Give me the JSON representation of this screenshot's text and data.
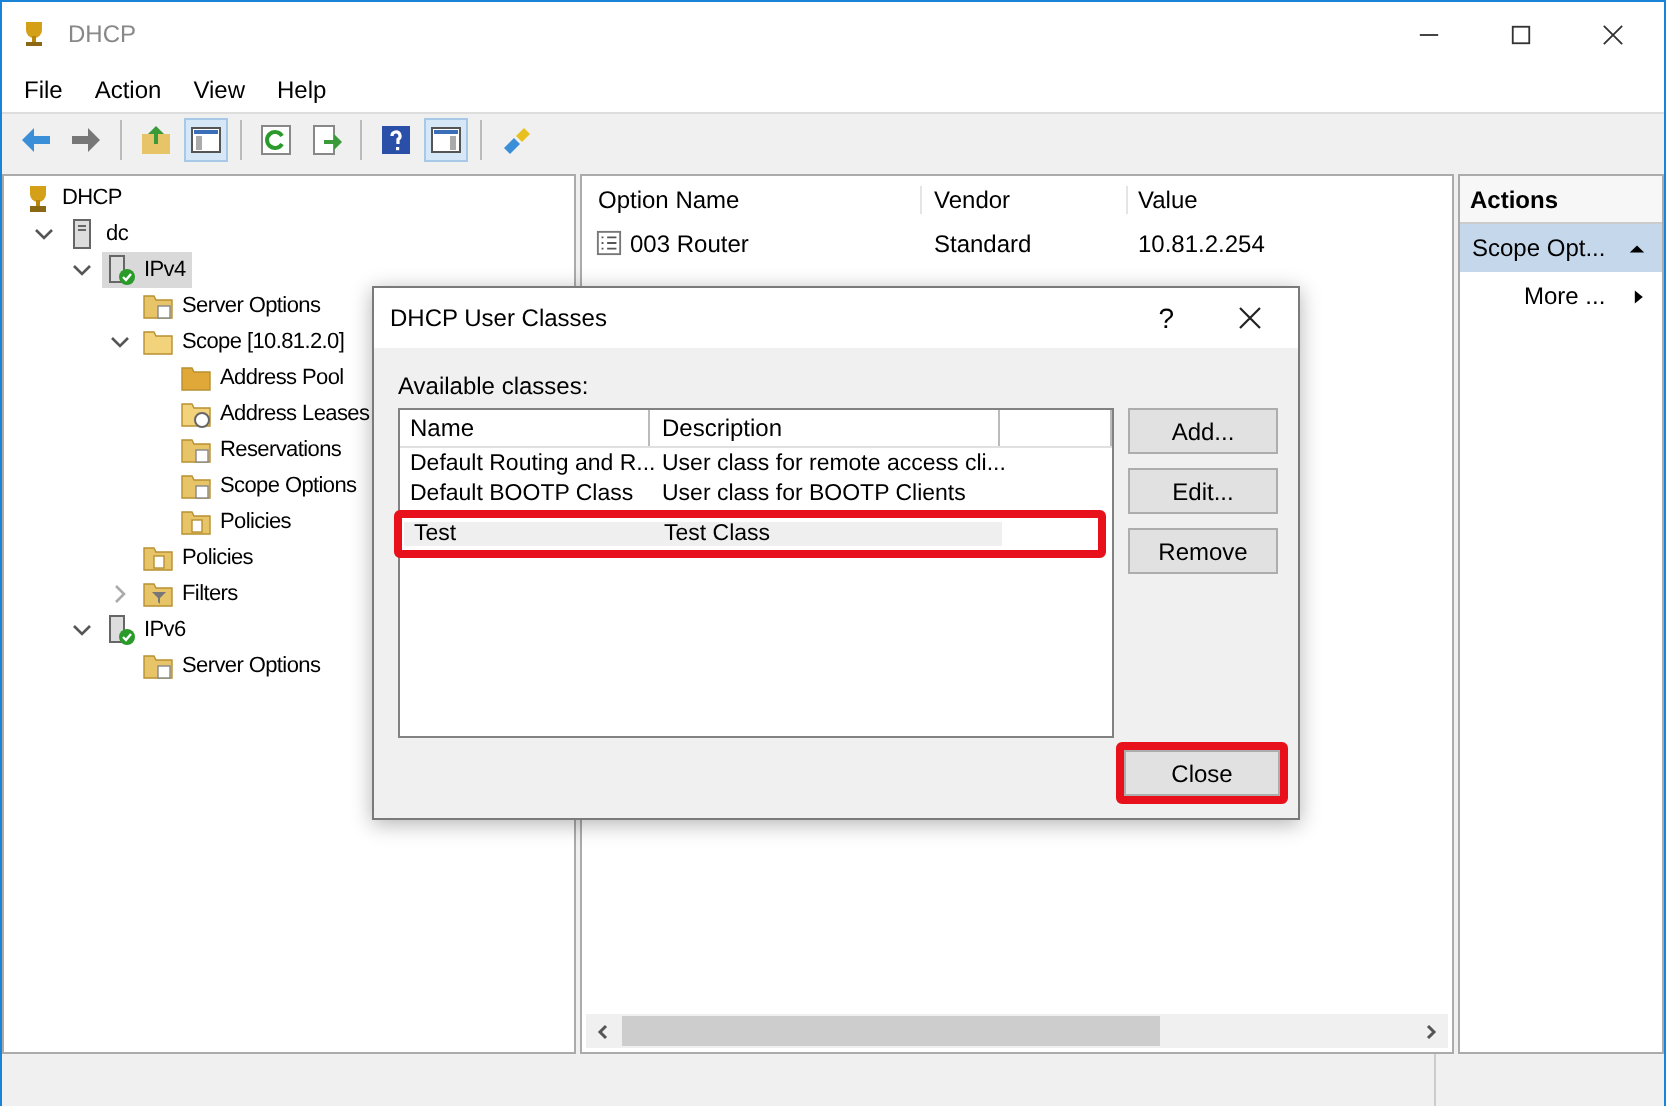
{
  "window": {
    "title": "DHCP"
  },
  "menu": [
    "File",
    "Action",
    "View",
    "Help"
  ],
  "toolbar": [
    {
      "kind": "back",
      "pressed": false
    },
    {
      "kind": "forward",
      "pressed": false
    },
    {
      "kind": "up",
      "pressed": false
    },
    {
      "kind": "tree",
      "pressed": true
    },
    {
      "kind": "refresh",
      "pressed": false
    },
    {
      "kind": "export",
      "pressed": false
    },
    {
      "kind": "help",
      "pressed": false
    },
    {
      "kind": "pane",
      "pressed": true
    },
    {
      "kind": "plugin",
      "pressed": false
    }
  ],
  "tree": [
    {
      "label": "DHCP",
      "kind": "root",
      "selected": false,
      "children": [
        {
          "label": "dc",
          "kind": "server",
          "expanded": true,
          "selected": false,
          "children": [
            {
              "label": "IPv4",
              "kind": "ip",
              "expanded": true,
              "selected": true,
              "children": [
                {
                  "label": "Server Options",
                  "kind": "options",
                  "selected": false
                },
                {
                  "label": "Scope [10.81.2.0]",
                  "kind": "folder",
                  "expanded": true,
                  "selected": false,
                  "children": [
                    {
                      "label": "Address Pool",
                      "kind": "pool",
                      "selected": false
                    },
                    {
                      "label": "Address Leases",
                      "kind": "leases",
                      "selected": false
                    },
                    {
                      "label": "Reservations",
                      "kind": "reservations",
                      "selected": false
                    },
                    {
                      "label": "Scope Options",
                      "kind": "options",
                      "selected": false
                    },
                    {
                      "label": "Policies",
                      "kind": "policy",
                      "selected": false
                    }
                  ]
                },
                {
                  "label": "Policies",
                  "kind": "policy",
                  "selected": false
                },
                {
                  "label": "Filters",
                  "kind": "filter",
                  "expanded": false,
                  "selected": false
                }
              ]
            },
            {
              "label": "IPv6",
              "kind": "ip",
              "expanded": true,
              "selected": false,
              "children": [
                {
                  "label": "Server Options",
                  "kind": "options",
                  "selected": false
                }
              ]
            }
          ]
        }
      ]
    }
  ],
  "list": {
    "columns": [
      "Option Name",
      "Vendor",
      "Value"
    ],
    "rows": [
      [
        "003 Router",
        "Standard",
        "10.81.2.254"
      ]
    ]
  },
  "actions": {
    "title": "Actions",
    "section": "Scope Opt...",
    "items": [
      "More ..."
    ]
  },
  "dialog": {
    "title": "DHCP User Classes",
    "help": "?",
    "label": "Available classes:",
    "columns": [
      "Name",
      "Description"
    ],
    "rows": [
      {
        "name": "Default Routing and R...",
        "description": "User class for remote access cli...",
        "selected": false,
        "highlighted": false
      },
      {
        "name": "Default BOOTP Class",
        "description": "User class for BOOTP Clients",
        "selected": false,
        "highlighted": false
      },
      {
        "name": "Test",
        "description": "Test Class",
        "selected": true,
        "highlighted": true
      }
    ],
    "buttons": [
      {
        "label": "Add...",
        "highlighted": false
      },
      {
        "label": "Edit...",
        "highlighted": false
      },
      {
        "label": "Remove",
        "highlighted": false
      }
    ],
    "close": {
      "label": "Close",
      "highlighted": true
    }
  }
}
